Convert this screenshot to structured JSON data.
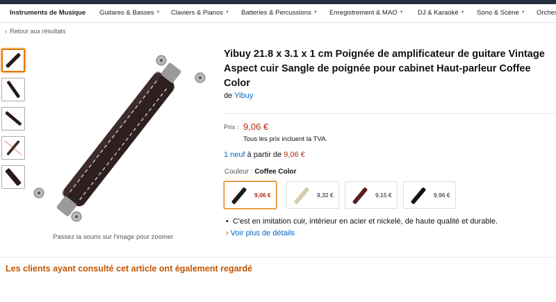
{
  "nav": {
    "items": [
      {
        "label": "Instruments de Musique",
        "has_caret": false
      },
      {
        "label": "Guitares & Basses",
        "has_caret": true
      },
      {
        "label": "Claviers & Pianos",
        "has_caret": true
      },
      {
        "label": "Batteries & Percussions",
        "has_caret": true
      },
      {
        "label": "Enregistrement & MAO",
        "has_caret": true
      },
      {
        "label": "DJ & Karaoké",
        "has_caret": true
      },
      {
        "label": "Sono & Scène",
        "has_caret": true
      },
      {
        "label": "Orches",
        "has_caret": false
      }
    ],
    "caret_icon": "chevron-down-icon"
  },
  "back_link": {
    "label": "Retour aux résultats",
    "icon": "chevron-left-icon"
  },
  "gallery": {
    "thumbnail_count": 5,
    "selected_index": 0,
    "zoom_hint": "Passez la souris sur l'image pour zoomer"
  },
  "product": {
    "title": "Yibuy 21.8 x 3.1 x 1 cm Poignée de amplificateur de guitare Vintage Aspect cuir Sangle de poignée pour cabinet Haut-parleur Coffee Color",
    "brand_prefix": "de",
    "brand": "Yibuy",
    "price_label": "Prix :",
    "price": "9,06 €",
    "vat_note": "Tous les prix incluent la TVA.",
    "offers": {
      "count_link": "1 neuf",
      "middle": "à partir de",
      "price": "9,06 €"
    },
    "color_label": "Couleur :",
    "color_value": "Coffee Color",
    "swatches": [
      {
        "price": "9,06 €",
        "color": "#1c1c1c",
        "selected": true
      },
      {
        "price": "9,32 €",
        "color": "#d8ccb0",
        "selected": false
      },
      {
        "price": "9,15 €",
        "color": "#5a1e1e",
        "selected": false
      },
      {
        "price": "9,96 €",
        "color": "#141414",
        "selected": false
      }
    ],
    "bullets": [
      "C'est en imitation cuir, intérieur en acier et nickelé, de haute qualité et durable."
    ],
    "more_details": "Voir plus de détails"
  },
  "related": {
    "heading": "Les clients ayant consulté cet article ont également regardé"
  },
  "colors": {
    "link": "#0066c0",
    "price": "#b12704",
    "accent": "#e77600",
    "section_heading": "#c45500"
  }
}
